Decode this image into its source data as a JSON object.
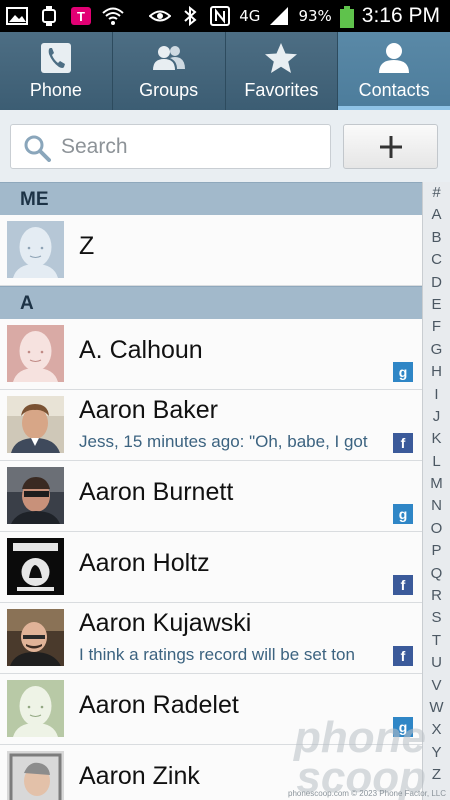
{
  "status_bar": {
    "left_icons": [
      "image-notification-icon",
      "watch-icon",
      "tmobile-icon",
      "wifi-icon"
    ],
    "right_icons": [
      "eye-icon",
      "bluetooth-icon",
      "nfc-icon",
      "4g-icon",
      "signal-icon",
      "battery-icon"
    ],
    "network": "4G",
    "battery": "93%",
    "time": "3:16 PM"
  },
  "tabs": [
    {
      "label": "Phone",
      "icon": "phone-icon",
      "active": false
    },
    {
      "label": "Groups",
      "icon": "groups-icon",
      "active": false
    },
    {
      "label": "Favorites",
      "icon": "star-icon",
      "active": false
    },
    {
      "label": "Contacts",
      "icon": "person-icon",
      "active": true
    }
  ],
  "search": {
    "placeholder": "Search",
    "value": ""
  },
  "sections": [
    {
      "header": "ME",
      "contacts": [
        {
          "name": "Z",
          "status": "",
          "badge": ""
        }
      ]
    },
    {
      "header": "A",
      "contacts": [
        {
          "name": "A. Calhoun",
          "status": "",
          "badge": "google"
        },
        {
          "name": "Aaron Baker",
          "status": "Jess, 15 minutes ago: \"Oh, babe, I got",
          "badge": "facebook"
        },
        {
          "name": "Aaron Burnett",
          "status": "",
          "badge": "google"
        },
        {
          "name": "Aaron Holtz",
          "status": "",
          "badge": "facebook"
        },
        {
          "name": "Aaron Kujawski",
          "status": "I think a ratings record will be set ton",
          "badge": "facebook"
        },
        {
          "name": "Aaron Radelet",
          "status": "",
          "badge": "google"
        },
        {
          "name": "Aaron Zink",
          "status": "",
          "badge": ""
        }
      ]
    }
  ],
  "index_letters": [
    "#",
    "A",
    "B",
    "C",
    "D",
    "E",
    "F",
    "G",
    "H",
    "I",
    "J",
    "K",
    "L",
    "M",
    "N",
    "O",
    "P",
    "Q",
    "R",
    "S",
    "T",
    "U",
    "V",
    "W",
    "X",
    "Y",
    "Z"
  ],
  "badge_labels": {
    "google": "g",
    "facebook": "f"
  },
  "watermark": {
    "brand_line1": "phone",
    "brand_line2": "scoop",
    "footer": "phonescoop.com © 2023 Phone Factor, LLC"
  },
  "colors": {
    "tab_active": "#4c7c9b",
    "tab_inactive": "#3c5d73",
    "section_header": "#a2b9cb",
    "google_badge": "#2f86c6",
    "facebook_badge": "#3b5a9a"
  }
}
